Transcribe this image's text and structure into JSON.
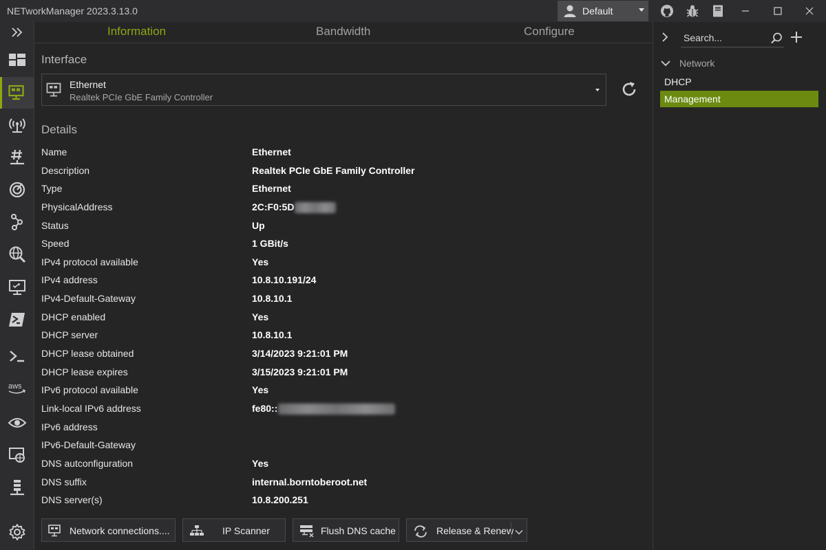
{
  "window": {
    "title": "NETworkManager 2023.3.13.0",
    "profile": "Default"
  },
  "tabs": [
    {
      "label": "Information",
      "active": true
    },
    {
      "label": "Bandwidth",
      "active": false
    },
    {
      "label": "Configure",
      "active": false
    }
  ],
  "interface": {
    "heading": "Interface",
    "name": "Ethernet",
    "description": "Realtek PCIe GbE Family Controller"
  },
  "details": {
    "heading": "Details",
    "rows": [
      {
        "key": "Name",
        "value": "Ethernet"
      },
      {
        "key": "Description",
        "value": "Realtek PCIe GbE Family Controller"
      },
      {
        "key": "Type",
        "value": "Ethernet"
      },
      {
        "key": "PhysicalAddress",
        "value": "2C:F0:5D"
      },
      {
        "key": "Status",
        "value": "Up"
      },
      {
        "key": "Speed",
        "value": "1 GBit/s"
      },
      {
        "key": "IPv4 protocol available",
        "value": "Yes"
      },
      {
        "key": "IPv4 address",
        "value": "10.8.10.191/24"
      },
      {
        "key": "IPv4-Default-Gateway",
        "value": "10.8.10.1"
      },
      {
        "key": "DHCP enabled",
        "value": "Yes"
      },
      {
        "key": "DHCP server",
        "value": "10.8.10.1"
      },
      {
        "key": "DHCP lease obtained",
        "value": "3/14/2023 9:21:01 PM"
      },
      {
        "key": "DHCP lease expires",
        "value": "3/15/2023 9:21:01 PM"
      },
      {
        "key": "IPv6 protocol available",
        "value": "Yes"
      },
      {
        "key": "Link-local IPv6 address",
        "value": "fe80::"
      },
      {
        "key": "IPv6 address",
        "value": ""
      },
      {
        "key": "IPv6-Default-Gateway",
        "value": ""
      },
      {
        "key": "DNS autconfiguration",
        "value": "Yes"
      },
      {
        "key": "DNS suffix",
        "value": "internal.borntoberoot.net"
      },
      {
        "key": "DNS server(s)",
        "value": "10.8.200.251"
      }
    ]
  },
  "actions": {
    "network_connections": "Network connections....",
    "ip_scanner": "IP Scanner",
    "flush_dns": "Flush DNS cache",
    "release_renew": "Release & Renew"
  },
  "profiles_panel": {
    "search_placeholder": "Search...",
    "group": "Network",
    "items": [
      {
        "label": "DHCP",
        "selected": false
      },
      {
        "label": "Management",
        "selected": true
      }
    ]
  },
  "colors": {
    "accent": "#8da812",
    "selection": "#6c8a10",
    "background": "#252526"
  }
}
